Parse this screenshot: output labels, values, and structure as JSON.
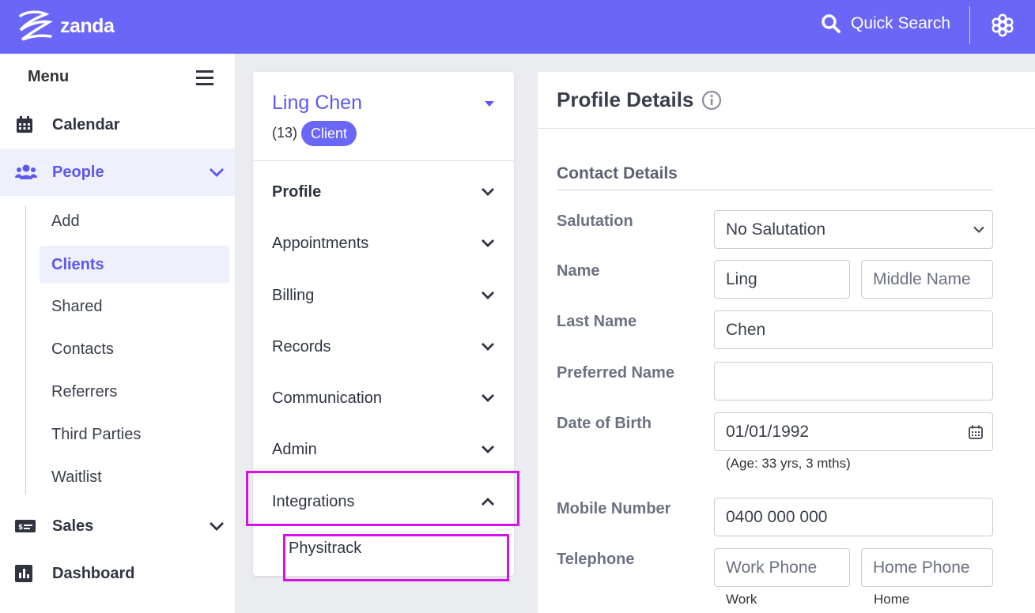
{
  "app": {
    "brand": "zanda",
    "quick_search": "Quick Search"
  },
  "sidebar": {
    "menu_label": "Menu",
    "items": [
      {
        "label": "Calendar",
        "icon": "calendar-icon"
      },
      {
        "label": "People",
        "icon": "people-icon",
        "active": true
      },
      {
        "label": "Sales",
        "icon": "sales-icon"
      },
      {
        "label": "Dashboard",
        "icon": "dashboard-icon"
      }
    ],
    "people_sub": [
      "Add",
      "Clients",
      "Shared",
      "Contacts",
      "Referrers",
      "Third Parties",
      "Waitlist"
    ],
    "active_sub": "Clients"
  },
  "client": {
    "name": "Ling Chen",
    "id": "(13)",
    "badge": "Client",
    "sections": [
      "Profile",
      "Appointments",
      "Billing",
      "Records",
      "Communication",
      "Admin",
      "Integrations"
    ],
    "integration_item": "Physitrack"
  },
  "profile": {
    "title": "Profile Details",
    "contact_title": "Contact Details",
    "labels": {
      "salutation": "Salutation",
      "name": "Name",
      "last_name": "Last Name",
      "preferred_name": "Preferred Name",
      "dob": "Date of Birth",
      "mobile": "Mobile Number",
      "telephone": "Telephone"
    },
    "values": {
      "salutation": "No Salutation",
      "first_name": "Ling",
      "middle_name_placeholder": "Middle Name",
      "last_name": "Chen",
      "preferred_name": "",
      "dob": "01/01/1992",
      "age_hint": "(Age: 33 yrs, 3 mths)",
      "mobile": "0400 000 000",
      "work_phone_placeholder": "Work Phone",
      "home_phone_placeholder": "Home Phone",
      "work_hint": "Work",
      "home_hint": "Home"
    }
  },
  "colors": {
    "brand": "#6a66f7",
    "accent": "#5c57f0",
    "highlight": "#d612e8"
  }
}
